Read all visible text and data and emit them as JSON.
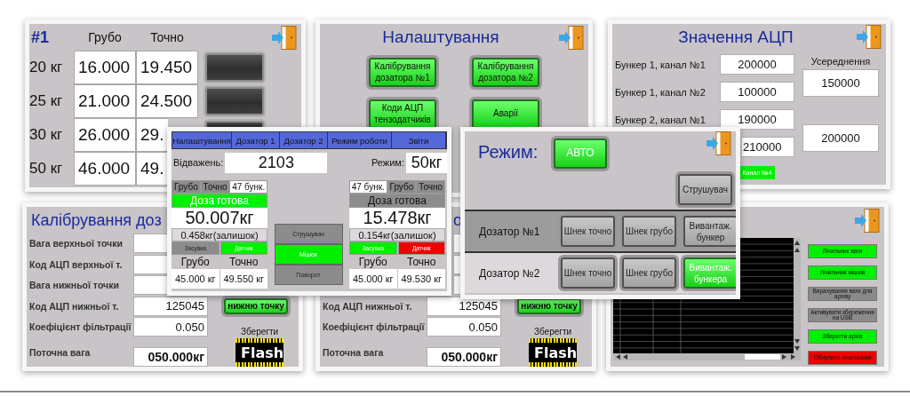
{
  "dosing_table": {
    "title": "#1",
    "columns": [
      "Грубо",
      "Точно"
    ],
    "rows": [
      {
        "label": "20 кг",
        "values": [
          "16.000",
          "19.450"
        ]
      },
      {
        "label": "25 кг",
        "values": [
          "21.000",
          "24.500"
        ]
      },
      {
        "label": "30 кг",
        "values": [
          "26.000",
          "29."
        ]
      },
      {
        "label": "50 кг",
        "values": [
          "46.000",
          "49."
        ]
      }
    ]
  },
  "settings_menu": {
    "title": "Налаштування",
    "buttons": [
      "Калібрування дозатора №1",
      "Калібрування дозатора №2",
      "Коди АЦП тензодатчиків",
      "Аварії"
    ]
  },
  "adc_values": {
    "title": "Значення АЦП",
    "rows": [
      {
        "label": "Бункер 1, канал №1",
        "value": "200000"
      },
      {
        "label": "Бункер 1, канал №2",
        "value": "100000"
      },
      {
        "label": "Бункер 2, канал №1",
        "value": "190000"
      },
      {
        "value": "210000"
      }
    ],
    "average_label": "Усереднення",
    "averages": [
      "150000",
      "200000"
    ],
    "channel_badge": "Канал №4"
  },
  "calibration_panels": [
    {
      "title": "Калібрування доз",
      "rows": [
        {
          "label": "Вага верхньої точки"
        },
        {
          "label": "Код АЦП верхньої т."
        },
        {
          "label": "Вага нижньої точки"
        },
        {
          "label": "Код АЦП нижньої т.",
          "value": "125045"
        },
        {
          "label": "Коефіцієнт фільтрації",
          "value": "0.050"
        },
        {
          "label": "Поточна вага",
          "value": "050.000кг",
          "kind": "total"
        }
      ],
      "button": "нижню точку",
      "save_label": "Зберегти",
      "flash": "Flash"
    },
    {
      "title": "о",
      "rows": [
        {},
        {},
        {},
        {
          "label": "Код АЦП нижньої т.",
          "value": "125045"
        },
        {
          "label": "Коефіцієнт фільтрації",
          "value": "0.050"
        },
        {
          "label": "Поточна вага",
          "value": "050.000кг",
          "kind": "total"
        }
      ],
      "button": "нижню точку",
      "save_label": "Зберегти",
      "flash": "Flash"
    }
  ],
  "archive": {
    "buttons": [
      {
        "label": "Лічильник ваги",
        "color": "#00f000"
      },
      {
        "label": "Лічильник мішків",
        "color": "#00f000"
      },
      {
        "label": "Вирахування ваги для архіву",
        "color": "#8a8a8a"
      },
      {
        "label": "Активувати збереження на USB",
        "color": "#8a8a8a"
      },
      {
        "label": "Зберегти архів",
        "color": "#00f000"
      },
      {
        "label": "Обнулити лічильники",
        "color": "#f00000"
      }
    ]
  },
  "main_screen": {
    "tabs": [
      {
        "label": "Налаштування",
        "selected": false
      },
      {
        "label": "Дозатор 1",
        "selected": false
      },
      {
        "label": "Дозатор 2",
        "selected": false
      },
      {
        "label": "Режим роботи",
        "selected": false
      },
      {
        "label": "Звіти",
        "selected": false
      }
    ],
    "count_label": "Відважень:",
    "count": "2103",
    "mode_label": "Режим:",
    "mode": "50кг",
    "dosers": [
      {
        "header": [
          {
            "label": "Грубо",
            "color": "#8c8c8c"
          },
          {
            "label": "Точно",
            "color": "#8c8c8c"
          },
          {
            "label": "47 бунк.",
            "color": "#ffffff"
          }
        ],
        "status": {
          "label": "Доза готова",
          "color": "#00f000"
        },
        "weight": "50.007кг",
        "remainder": "0.458кг(залишок)",
        "lamps": [
          {
            "label": "Засувка",
            "color": "#8c8c8c"
          },
          {
            "label": "Датчик",
            "color": "#00f000"
          }
        ],
        "columns": [
          "Грубо",
          "Точно"
        ],
        "values": [
          "45.000 кг",
          "49.550 кг"
        ]
      },
      {
        "header": [
          {
            "label": "47 бунк.",
            "color": "#ffffff"
          },
          {
            "label": "Грубо",
            "color": "#8c8c8c"
          },
          {
            "label": "Точно",
            "color": "#8c8c8c"
          }
        ],
        "status": {
          "label": "Доза готова",
          "color": "#8c8c8c"
        },
        "weight": "15.478кг",
        "remainder": "0.154кг(залишок)",
        "lamps": [
          {
            "label": "Засувка",
            "color": "#00f000"
          },
          {
            "label": "Датчик",
            "color": "#f00000"
          }
        ],
        "columns": [
          "Грубо",
          "Точно"
        ],
        "values": [
          "45.000 кг",
          "49.530 кг"
        ]
      }
    ],
    "actuators": [
      {
        "label": "Струшувач",
        "color": "#8c8c8c"
      },
      {
        "label": "Мішок",
        "color": "#00f000"
      },
      {
        "label": "Поворот",
        "color": "#8c8c8c"
      }
    ]
  },
  "mode_screen": {
    "label": "Режим:",
    "mode_button": {
      "label": "АВТО",
      "on": true
    },
    "shaker": {
      "label": "Струшувач",
      "on": false
    },
    "dosers": [
      {
        "label": "Дозатор №1",
        "selected": true,
        "buttons": [
          {
            "label": "Шнек точно",
            "on": false
          },
          {
            "label": "Шнек грубо",
            "on": false
          },
          {
            "label": "Вивантаж. бункер",
            "on": false
          }
        ]
      },
      {
        "label": "Дозатор №2",
        "selected": false,
        "buttons": [
          {
            "label": "Шнек точно",
            "on": false
          },
          {
            "label": "Шнек грубо",
            "on": false
          },
          {
            "label": "Вивантаж. бункера",
            "on": true
          }
        ]
      }
    ]
  }
}
